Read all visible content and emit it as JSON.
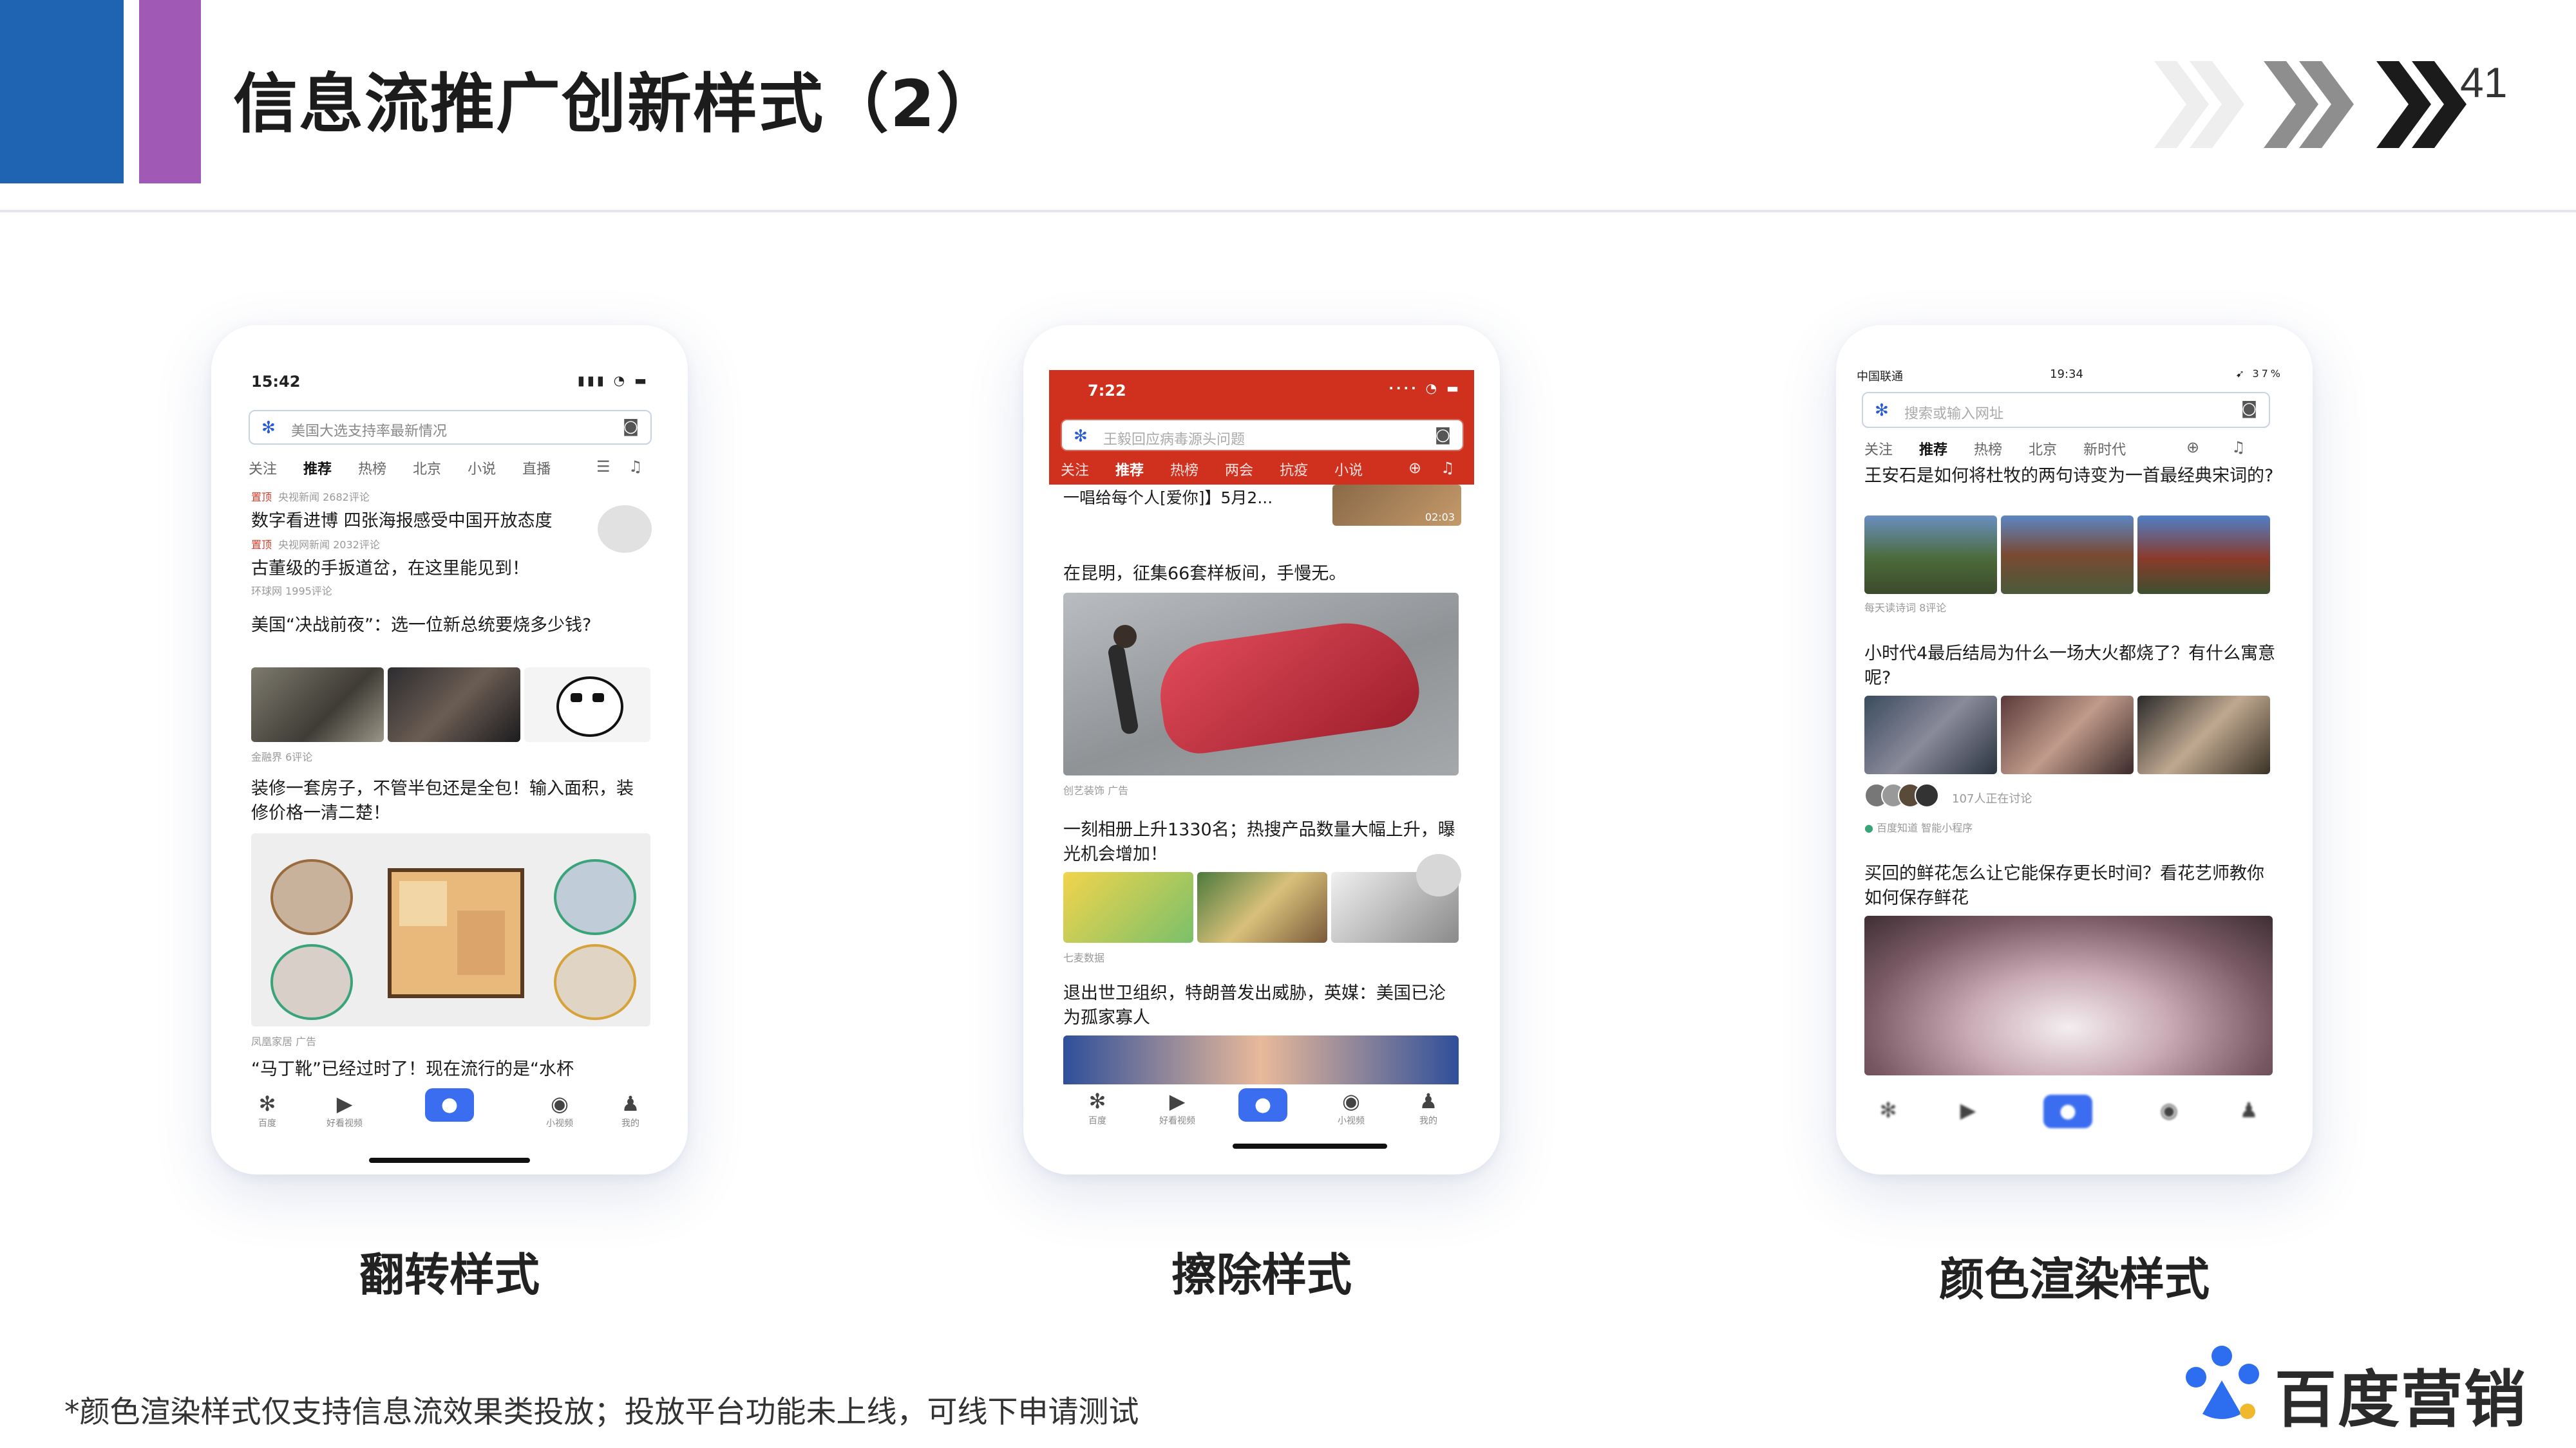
{
  "header": {
    "title": "信息流推广创新样式（2）",
    "page_number": "41",
    "colors": {
      "blue": "#1f63b3",
      "purple": "#a05ab5"
    }
  },
  "phones": [
    {
      "caption": "翻转样式",
      "status_time": "15:42",
      "search_placeholder": "美国大选支持率最新情况",
      "tabs": [
        "关注",
        "推荐",
        "热榜",
        "北京",
        "小说",
        "直播"
      ],
      "active_tab": "推荐",
      "feed": [
        {
          "meta_tag": "置顶",
          "meta_source": "央视新闻  2682评论"
        },
        {
          "title": "数字看进博 四张海报感受中国开放态度",
          "meta_tag": "置顶",
          "meta_source": "央视网新闻  2032评论"
        },
        {
          "title": "古董级的手扳道岔，在这里能见到！",
          "meta_source": "环球网  1995评论"
        },
        {
          "title": "美国“决战前夜”：选一位新总统要烧多少钱?",
          "meta_source": "金融界  6评论"
        },
        {
          "title": "装修一套房子，不管半包还是全包！输入面积，装修价格一清二楚！",
          "meta_source": "凤凰家居  广告"
        },
        {
          "title": "“马丁靴”已经过时了！现在流行的是“水杯"
        }
      ],
      "nav": [
        "百度",
        "好看视频",
        "小视频",
        "我的"
      ]
    },
    {
      "caption": "擦除样式",
      "status_time": "7:22",
      "search_placeholder": "王毅回应病毒源头问题",
      "tabs": [
        "关注",
        "推荐",
        "热榜",
        "两会",
        "抗疫",
        "小说"
      ],
      "active_tab": "推荐",
      "accent_color": "#d0311f",
      "feed": [
        {
          "title": "一唱给每个人[爱你]】5月2...",
          "duration": "02:03"
        },
        {
          "title": "在昆明，征集66套样板间，手慢无。",
          "meta_source": "创艺装饰  广告"
        },
        {
          "title": "一刻相册上升1330名；热搜产品数量大幅上升，曝光机会增加！",
          "meta_source": "七麦数据"
        },
        {
          "title": "退出世卫组织，特朗普发出威胁，英媒：美国已沦为孤家寡人"
        }
      ],
      "nav": [
        "百度",
        "好看视频",
        "小视频",
        "我的"
      ]
    },
    {
      "caption": "颜色渲染样式",
      "status_carrier": "中国联通",
      "status_time": "19:34",
      "status_battery": "37%",
      "search_placeholder": "搜索或输入网址",
      "tabs": [
        "关注",
        "推荐",
        "热榜",
        "北京",
        "新时代"
      ],
      "active_tab": "推荐",
      "feed": [
        {
          "title": "王安石是如何将杜牧的两句诗变为一首最经典宋词的?",
          "meta_source": "每天读诗词  8评论"
        },
        {
          "title": "小时代4最后结局为什么一场大火都烧了？有什么寓意呢?",
          "discussion": "107人正在讨论",
          "meta_source": "百度知道  智能小程序"
        },
        {
          "title": "买回的鲜花怎么让它能保存更长时间？看花艺师教你如何保存鲜花"
        }
      ]
    }
  ],
  "footnote": "*颜色渲染样式仅支持信息流效果类投放；投放平台功能未上线，可线下申请测试",
  "brand": "百度营销"
}
